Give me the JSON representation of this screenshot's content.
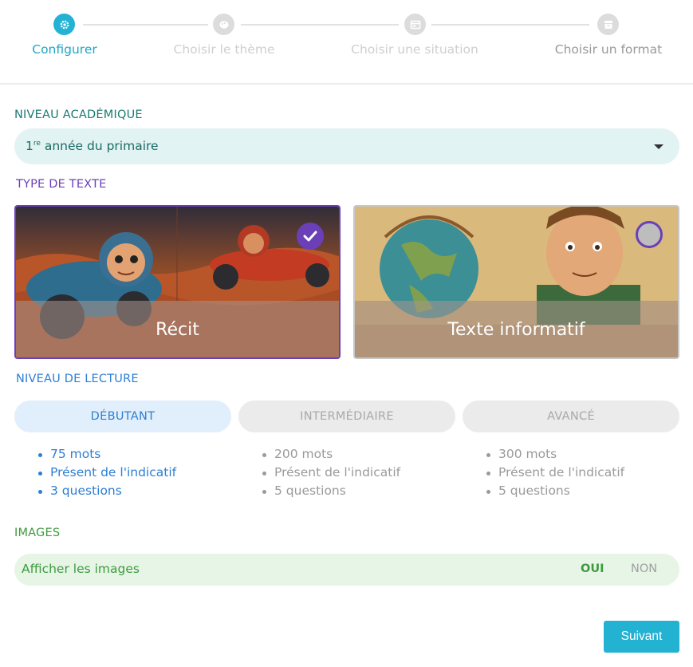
{
  "stepper": {
    "steps": [
      {
        "label": "Configurer",
        "icon": "gear-icon"
      },
      {
        "label": "Choisir le thème",
        "icon": "palette-icon"
      },
      {
        "label": "Choisir une situation",
        "icon": "window-icon"
      },
      {
        "label": "Choisir un format",
        "icon": "archive-icon"
      }
    ]
  },
  "academic": {
    "title": "NIVEAU ACADÉMIQUE",
    "value_prefix": "1",
    "value_sup": "re",
    "value_rest": " année du primaire"
  },
  "text_type": {
    "title": "TYPE DE TEXTE",
    "cards": [
      {
        "label": "Récit",
        "selected": true
      },
      {
        "label": "Texte informatif",
        "selected": false
      }
    ]
  },
  "reading_level": {
    "title": "NIVEAU DE LECTURE",
    "levels": [
      {
        "label": "DÉBUTANT",
        "selected": true,
        "details": [
          "75 mots",
          "Présent de l'indicatif",
          "3 questions"
        ]
      },
      {
        "label": "INTERMÉDIAIRE",
        "selected": false,
        "details": [
          "200 mots",
          "Présent de l'indicatif",
          "5 questions"
        ]
      },
      {
        "label": "AVANCÉ",
        "selected": false,
        "details": [
          "300 mots",
          "Présent de l'indicatif",
          "5 questions"
        ]
      }
    ]
  },
  "images": {
    "title": "IMAGES",
    "label": "Afficher les images",
    "yes": "OUI",
    "no": "NON"
  },
  "next_button": "Suivant",
  "colors": {
    "accent": "#24b2d3",
    "selected_purple": "#6a3fb8",
    "teal_text": "#1c6b65",
    "blue_text": "#2d7fd4",
    "green_text": "#3f9a3f"
  }
}
